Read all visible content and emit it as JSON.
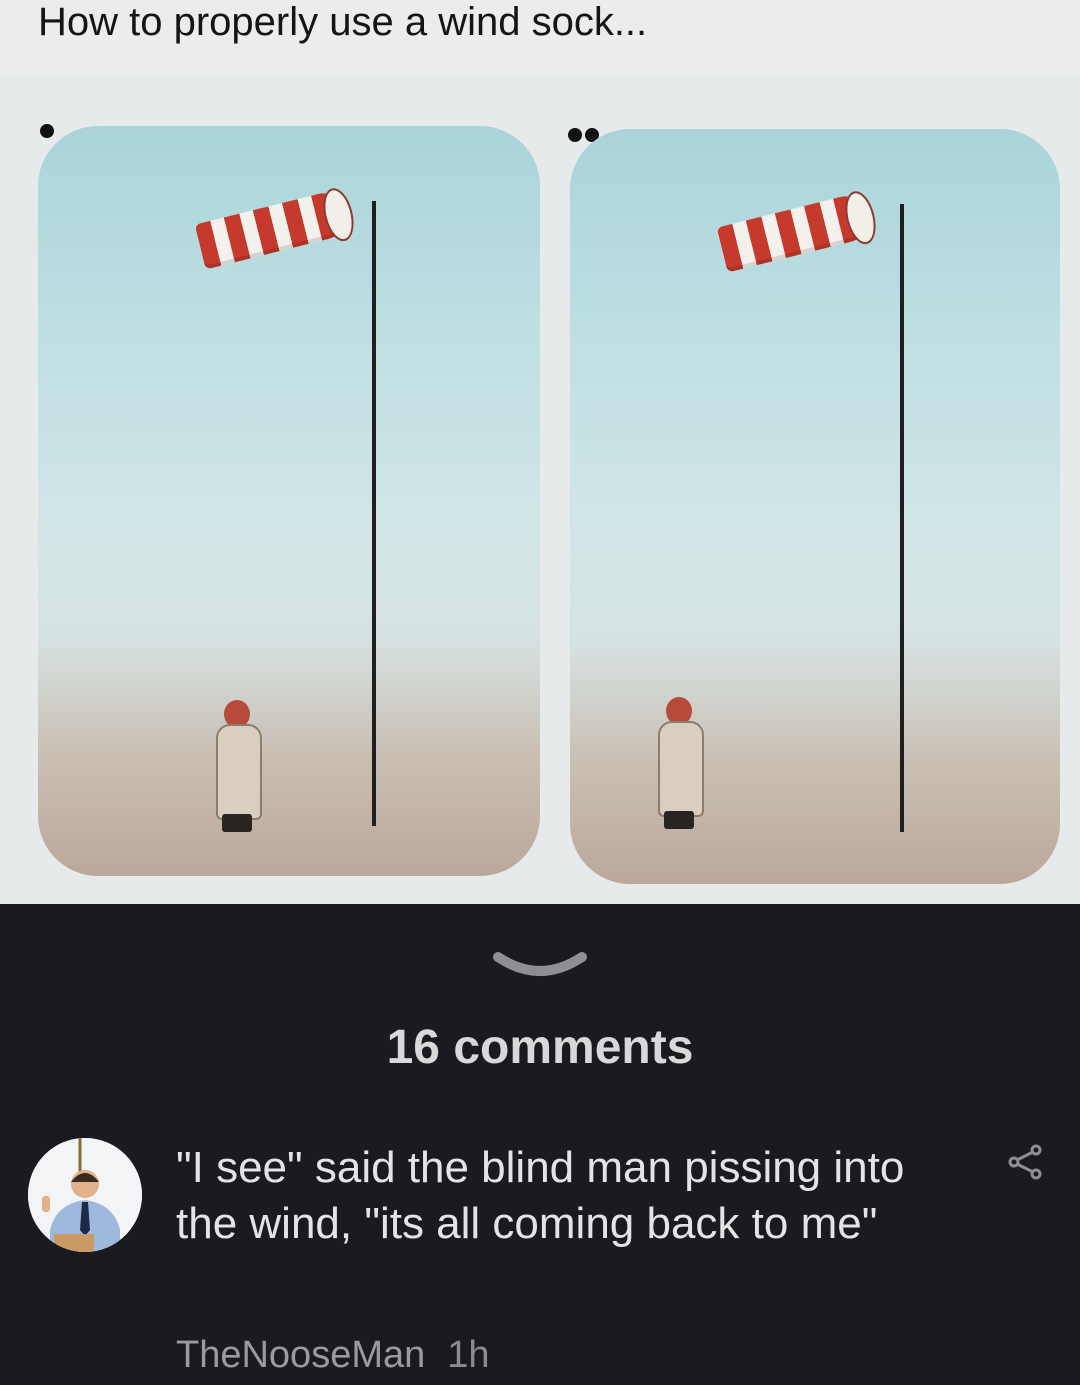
{
  "post": {
    "caption": "How to properly use a wind sock..."
  },
  "cartoon": {
    "panel_markers": [
      "•",
      "••"
    ]
  },
  "comments": {
    "count_label": "16 comments",
    "items": [
      {
        "text": "\"I see\" said the blind man pissing into the wind, \"its all coming back to me\"",
        "author": "TheNooseMan",
        "time": "1h"
      }
    ]
  },
  "icons": {
    "expand": "chevron-down-icon",
    "share": "share-icon"
  },
  "colors": {
    "background": "#1a1b20",
    "caption_bar": "#ececec",
    "text_primary": "#e4e4e4",
    "text_secondary": "#9b9b9b"
  }
}
